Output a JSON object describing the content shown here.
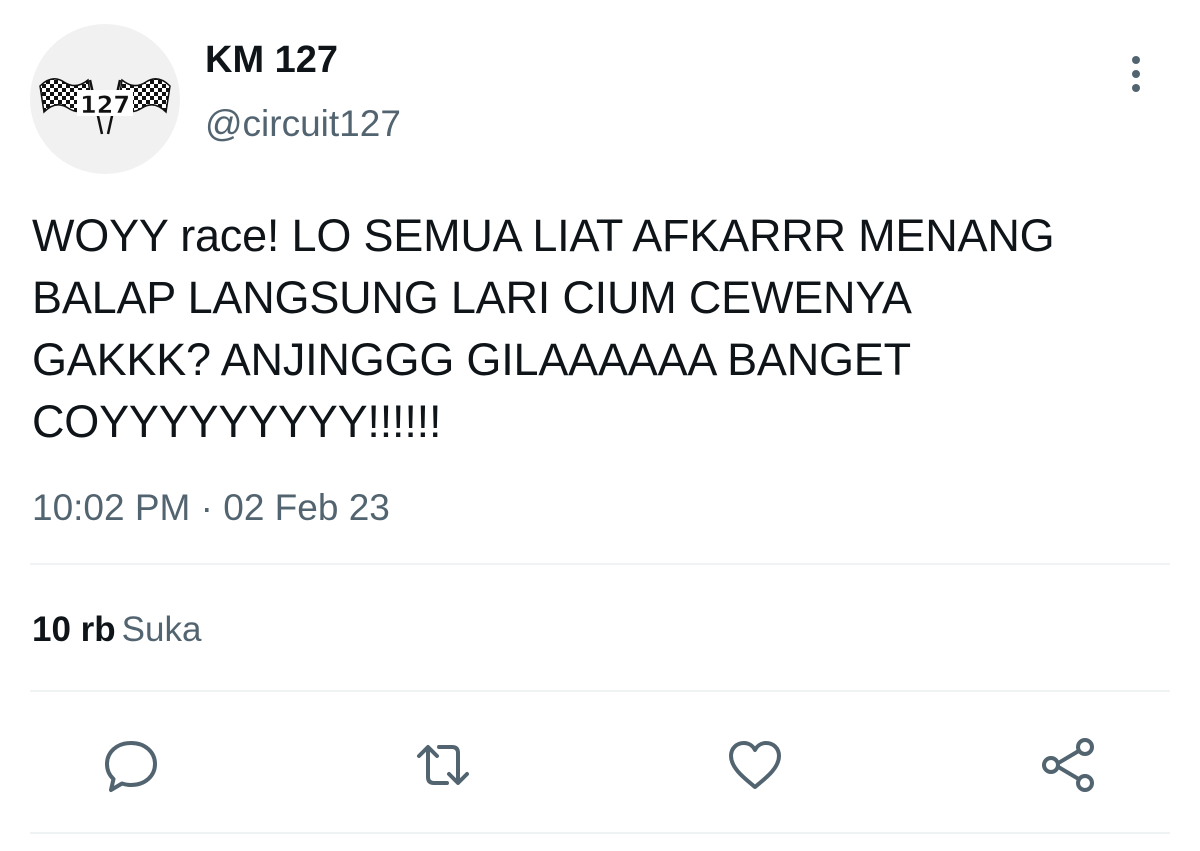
{
  "user": {
    "display_name": "KM 127",
    "handle": "@circuit127",
    "avatar_icon": "checkered-flags-127-logo"
  },
  "tweet": {
    "text": "WOYY race! LO SEMUA LIAT AFKARRR MENANG\nBALAP LANGSUNG LARI CIUM CEWENYA\nGAKKK? ANJINGGG GILAAAAAA BANGET\nCOYYYYYYYYY!!!!!!",
    "timestamp": "10:02 PM · 02 Feb 23"
  },
  "stats": {
    "likes_count": "10 rb",
    "likes_label": "Suka"
  },
  "actions": {
    "icons": [
      "reply-icon",
      "retweet-icon",
      "like-icon",
      "share-icon"
    ],
    "icon_color": "#536471"
  },
  "menu": {
    "icon": "more-vertical-icon"
  },
  "colors": {
    "text_primary": "#0f1419",
    "text_secondary": "#536471",
    "divider": "#eff3f4"
  }
}
